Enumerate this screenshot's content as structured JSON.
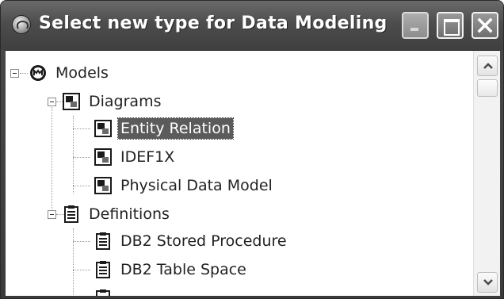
{
  "window": {
    "title": "Select new type for Data Modeling",
    "icon": "data-modeling-app-icon",
    "controls": [
      "minimize",
      "maximize",
      "close"
    ]
  },
  "tree": {
    "selected_item": "Entity Relation",
    "nodes": [
      {
        "label": "Models",
        "icon": "models-icon",
        "level": 0,
        "expanded": true
      },
      {
        "label": "Diagrams",
        "icon": "diagram-folder-icon",
        "level": 1,
        "expanded": true
      },
      {
        "label": "Entity Relation",
        "icon": "diagram-icon",
        "level": 2,
        "selected": true
      },
      {
        "label": "IDEF1X",
        "icon": "diagram-icon",
        "level": 2
      },
      {
        "label": "Physical Data Model",
        "icon": "diagram-icon",
        "level": 2
      },
      {
        "label": "Definitions",
        "icon": "definition-folder-icon",
        "level": 1,
        "expanded": true
      },
      {
        "label": "DB2 Stored Procedure",
        "icon": "definition-icon",
        "level": 2
      },
      {
        "label": "DB2 Table Space",
        "icon": "definition-icon",
        "level": 2
      }
    ]
  },
  "colors": {
    "titlebar": "#4d4d4d",
    "selection": "#5b5b5b",
    "background": "#ffffff"
  }
}
